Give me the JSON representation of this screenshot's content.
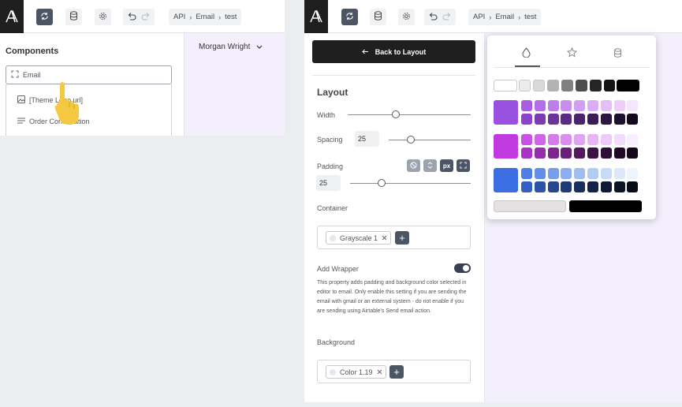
{
  "left": {
    "breadcrumb": [
      "API",
      "Email",
      "test"
    ],
    "components_title": "Components",
    "search_value": "Email",
    "items": [
      "[Theme Logo url]",
      "Order Confirmation"
    ],
    "user_name": "Morgan Wright"
  },
  "right": {
    "breadcrumb": [
      "API",
      "Email",
      "test"
    ],
    "back_label": "Back to Layout",
    "layout_title": "Layout",
    "width_label": "Width",
    "width_level": 0.39,
    "spacing_label": "Spacing",
    "spacing_value": "25",
    "spacing_level": 0.27,
    "padding_label": "Padding",
    "padding_value": "25",
    "padding_level": 0.26,
    "padding_unit": "px",
    "container_label": "Container",
    "container_chip": "Grayscale 1",
    "wrapper_label": "Add Wrapper",
    "wrapper_enabled": true,
    "wrapper_desc": "This property adds padding and background color selected in editor to email. Only enable this setting if you are sending the email with gmail or an external system - do not enable if you are sending using Airtable's Send email action.",
    "background_label": "Background",
    "background_chip": "Color 1.19"
  },
  "palette": {
    "tabs": [
      "droplet-icon",
      "star-icon",
      "database-icon"
    ],
    "grays": [
      "#ffffff",
      "#ececec",
      "#d9d9d9",
      "#b3b3b3",
      "#808080",
      "#4d4d4d",
      "#262626",
      "#141414",
      "#000000"
    ],
    "purple": {
      "main": "#9b51e0",
      "row1": [
        "#a95ee2",
        "#b36ee6",
        "#bd7ee9",
        "#c78eec",
        "#d19ef0",
        "#dbaef3",
        "#e4bef6",
        "#eecef9",
        "#f6e6fc"
      ],
      "row2": [
        "#8a44c8",
        "#7a3db1",
        "#6a359a",
        "#5a2d83",
        "#4a256c",
        "#3a1d55",
        "#2d1742",
        "#20102f",
        "#14091d"
      ]
    },
    "magenta": {
      "main": "#c03ae0",
      "row1": [
        "#c852e4",
        "#cf66e8",
        "#d67aec",
        "#dc8ef0",
        "#e2a2f3",
        "#e8b6f6",
        "#eecaf9",
        "#f3dcfb",
        "#f9eefd"
      ],
      "row2": [
        "#a833c5",
        "#932da9",
        "#7d268f",
        "#672075",
        "#52195c",
        "#3d1345",
        "#2e0e35",
        "#200a25",
        "#130616"
      ]
    },
    "blue": {
      "main": "#3b6ee0",
      "row1": [
        "#4f7ee4",
        "#638ee8",
        "#779eeb",
        "#8baeee",
        "#9fbdf1",
        "#b3ccf4",
        "#c7dbf7",
        "#dbe8fa",
        "#eef4fd"
      ],
      "row2": [
        "#335fc3",
        "#2c52a8",
        "#26468e",
        "#1f3a74",
        "#192e5c",
        "#132346",
        "#0f1b36",
        "#0b1327",
        "#060b18"
      ]
    },
    "bottom": [
      "#e5e0e0",
      "#000000"
    ]
  }
}
